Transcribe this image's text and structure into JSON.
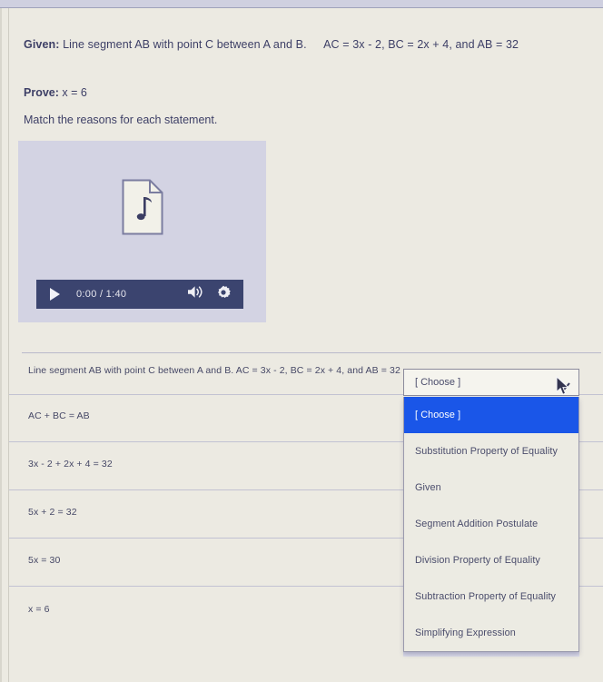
{
  "problem": {
    "given_label": "Given:",
    "given_text": "Line segment AB with point C between A and B.",
    "given_equations": "AC = 3x - 2, BC = 2x + 4, and AB = 32",
    "prove_label": "Prove:",
    "prove_value": "x = 6",
    "instruction": "Match the reasons for each statement."
  },
  "media_player": {
    "time_display": "0:00 / 1:40",
    "play_icon": "play-icon",
    "volume_icon": "volume-icon",
    "settings_icon": "gear-icon",
    "thumbnail_icon": "audio-file-icon",
    "background_color": "#d3d3e3",
    "control_bar_color": "#3b446f"
  },
  "proof_table": {
    "rows": [
      {
        "statement": "Line segment AB with point C between A and B.   AC = 3x - 2, BC = 2x + 4, and AB = 32"
      },
      {
        "statement": "AC + BC = AB"
      },
      {
        "statement": "3x - 2 + 2x + 4 = 32"
      },
      {
        "statement": "5x + 2 = 32"
      },
      {
        "statement": "5x = 30"
      },
      {
        "statement": "x = 6"
      }
    ]
  },
  "reason_select": {
    "selected_value": "[ Choose ]",
    "chevron_icon": "chevron-down-icon",
    "highlight_color": "#1a56e8",
    "options": [
      "[ Choose ]",
      "Substitution Property of Equality",
      "Given",
      "Segment Addition Postulate",
      "Division Property of Equality",
      "Subtraction Property of Equality",
      "Simplifying Expression"
    ]
  },
  "cursor": {
    "icon": "mouse-pointer-icon"
  }
}
